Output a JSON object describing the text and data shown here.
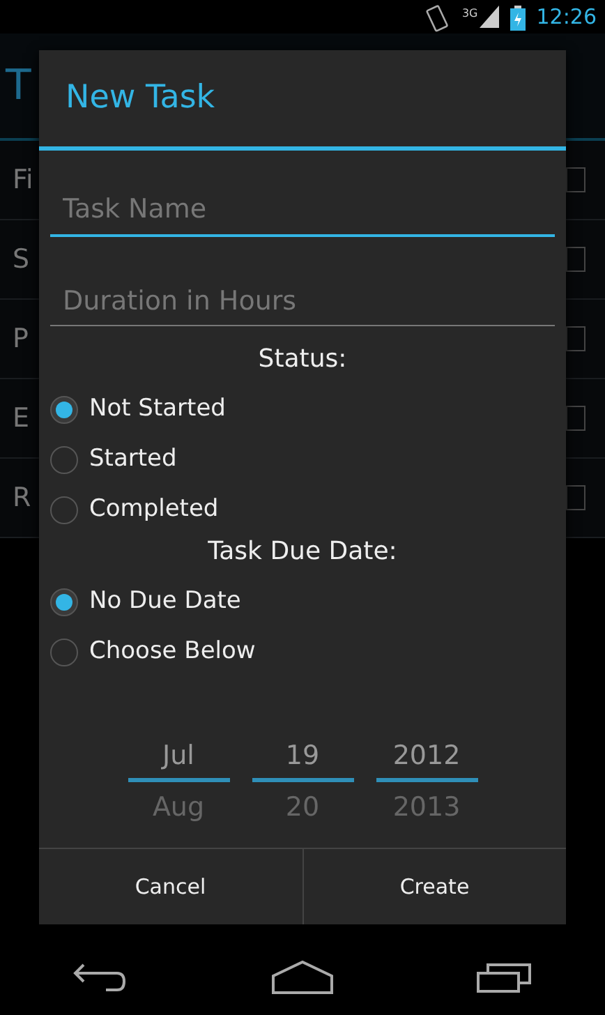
{
  "status_bar": {
    "time": "12:26",
    "network": "3G"
  },
  "background_app": {
    "title": "T",
    "rows": [
      {
        "label": "Fi",
        "checked": false
      },
      {
        "label": "S",
        "checked": false
      },
      {
        "label": "P",
        "checked": false
      },
      {
        "label": "E",
        "checked": false
      },
      {
        "label": "R",
        "checked": false
      }
    ]
  },
  "dialog": {
    "title": "New Task",
    "fields": [
      {
        "placeholder": "Task Name",
        "focused": true
      },
      {
        "placeholder": "Duration in Hours",
        "focused": false
      }
    ],
    "groups": [
      {
        "label": "Status:",
        "options": [
          {
            "label": "Not Started",
            "selected": true
          },
          {
            "label": "Started",
            "selected": false
          },
          {
            "label": "Completed",
            "selected": false
          }
        ]
      },
      {
        "label": "Task Due Date:",
        "options": [
          {
            "label": "No Due Date",
            "selected": true
          },
          {
            "label": "Choose Below",
            "selected": false
          }
        ]
      }
    ],
    "date_picker": [
      {
        "current": "Jul",
        "next": "Aug"
      },
      {
        "current": "19",
        "next": "20"
      },
      {
        "current": "2012",
        "next": "2013"
      }
    ],
    "buttons": [
      "Cancel",
      "Create"
    ]
  }
}
